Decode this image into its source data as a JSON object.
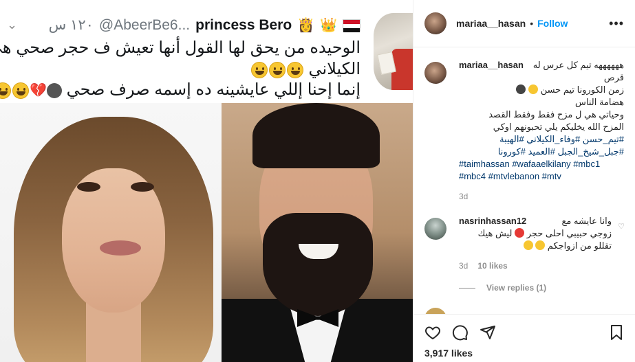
{
  "tweet": {
    "time": "١٢٠ س",
    "handle": "@AbeerBe6...",
    "name": "princess Bero",
    "line1": "الوحيده من يحق لها القول أنها تعيش ف حجر صحي هي وفاء",
    "line2": "الكيلاني",
    "line3": "إنما إحنا إللي عايشينه ده إسمه صرف صحي"
  },
  "post": {
    "username": "mariaa__hasan",
    "separator": "•",
    "follow_label": "Follow",
    "caption": {
      "line1": "ههههههه تيم كل عرس له قرص",
      "line1b": "زمن الكورونا تيم حسن",
      "line2": "هضامة الناس",
      "line3": "وحياتي هي ل مزح فقط وفقط القصد",
      "line4": "المزح الله يخليكم يلي تحبونهم اوكي",
      "tags1": "#تيم_حسن #وفاء_الكيلاني #الهيبة",
      "tags2": "#جبل_شيخ_الجبل #العميد #كورونا",
      "tags3": "#taimhassan #wafaaelkilany #mbc1",
      "tags4": "#mbc4 #mtvlebanon #mtv",
      "time": "3d"
    },
    "comment": {
      "username": "nasrinhassan12",
      "text1": "وانا عايشه مع",
      "text2": "زوجي حبيبي احلى حجر",
      "text2b": "ليش هيك",
      "text3": "تقللو من ازواجكم",
      "time": "3d",
      "likes": "10 likes",
      "view_replies": "View replies (1)"
    },
    "likes_count": "3,917 likes"
  },
  "colors": {
    "accent": "#0095f6",
    "hashtag": "#00376b",
    "muted": "#8e8e8e"
  }
}
